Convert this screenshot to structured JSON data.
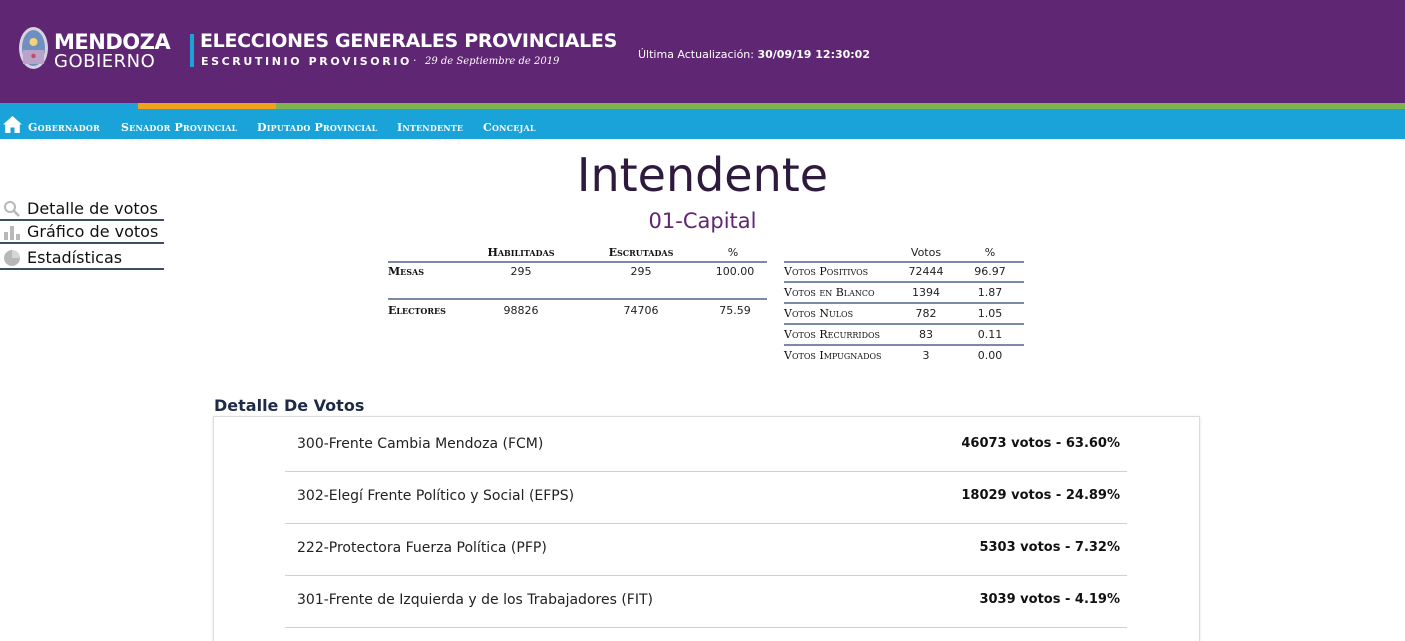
{
  "header": {
    "logo_line1": "MENDOZA",
    "logo_line2": "GOBIERNO",
    "title": "ELECCIONES GENERALES PROVINCIALES",
    "subtitle": "ESCRUTINIO PROVISORIO",
    "separator": "·",
    "date": "29 de Septiembre de 2019",
    "update_label": "Última Actualización:",
    "update_value": "30/09/19 12:30:02"
  },
  "nav": {
    "home_icon": "home-icon",
    "items": [
      "Gobernador",
      "Senador Provincial",
      "Diputado Provincial",
      "Intendente",
      "Concejal"
    ]
  },
  "sidebar": {
    "items": [
      {
        "label": "Detalle de votos",
        "icon": "magnifier-icon"
      },
      {
        "label": "Gráfico de votos",
        "icon": "bar-chart-icon"
      },
      {
        "label": "Estadísticas",
        "icon": "pie-chart-icon"
      }
    ]
  },
  "page": {
    "title": "Intendente",
    "district": "01-Capital"
  },
  "mesas_table": {
    "headers": [
      "Habilitadas",
      "Escrutadas",
      "%"
    ],
    "rows": [
      {
        "label": "Mesas",
        "values": [
          "295",
          "295",
          "100.00"
        ]
      },
      {
        "label": "Electores",
        "values": [
          "98826",
          "74706",
          "75.59"
        ]
      }
    ]
  },
  "votos_table": {
    "headers": [
      "Votos",
      "%"
    ],
    "rows": [
      {
        "label": "Votos Positivos",
        "values": [
          "72444",
          "96.97"
        ]
      },
      {
        "label": "Votos en Blanco",
        "values": [
          "1394",
          "1.87"
        ]
      },
      {
        "label": "Votos Nulos",
        "values": [
          "782",
          "1.05"
        ]
      },
      {
        "label": "Votos Recurridos",
        "values": [
          "83",
          "0.11"
        ]
      },
      {
        "label": "Votos Impugnados",
        "values": [
          "3",
          "0.00"
        ]
      }
    ]
  },
  "detail": {
    "title": "Detalle De Votos",
    "parties": [
      {
        "name": "300-Frente Cambia Mendoza (FCM)",
        "result": "46073 votos - 63.60%"
      },
      {
        "name": "302-Elegí Frente Político y Social (EFPS)",
        "result": "18029 votos - 24.89%"
      },
      {
        "name": "222-Protectora Fuerza Política (PFP)",
        "result": "5303 votos - 7.32%"
      },
      {
        "name": "301-Frente de Izquierda y de los Trabajadores (FIT)",
        "result": "3039 votos - 4.19%"
      }
    ]
  },
  "colors": {
    "header_purple": "#5f2673",
    "nav_blue": "#1aa3d8",
    "accent_orange": "#f0a21a",
    "accent_green": "#7fb34d"
  }
}
